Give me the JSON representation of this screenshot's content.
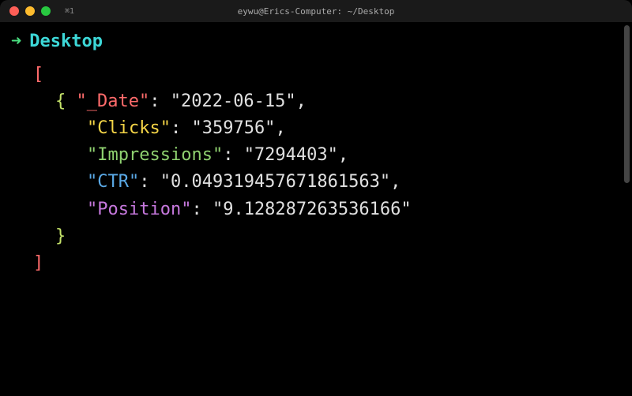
{
  "window": {
    "title": "eywu@Erics-Computer: ~/Desktop",
    "tab_indicator": "⌘1"
  },
  "prompt": {
    "arrow": "➜",
    "cwd": "Desktop"
  },
  "output": {
    "open_bracket": "[",
    "open_curly": "{",
    "entries": {
      "date_key": "\"_Date\"",
      "date_val": "\"2022-06-15\"",
      "clicks_key": "\"Clicks\"",
      "clicks_val": "\"359756\"",
      "impressions_key": "\"Impressions\"",
      "impressions_val": "\"7294403\"",
      "ctr_key": "\"CTR\"",
      "ctr_val": "\"0.049319457671861563\"",
      "position_key": "\"Position\"",
      "position_val": "\"9.128287263536166\""
    },
    "close_curly": "}",
    "close_bracket": "]",
    "colon": ": ",
    "comma": ","
  }
}
